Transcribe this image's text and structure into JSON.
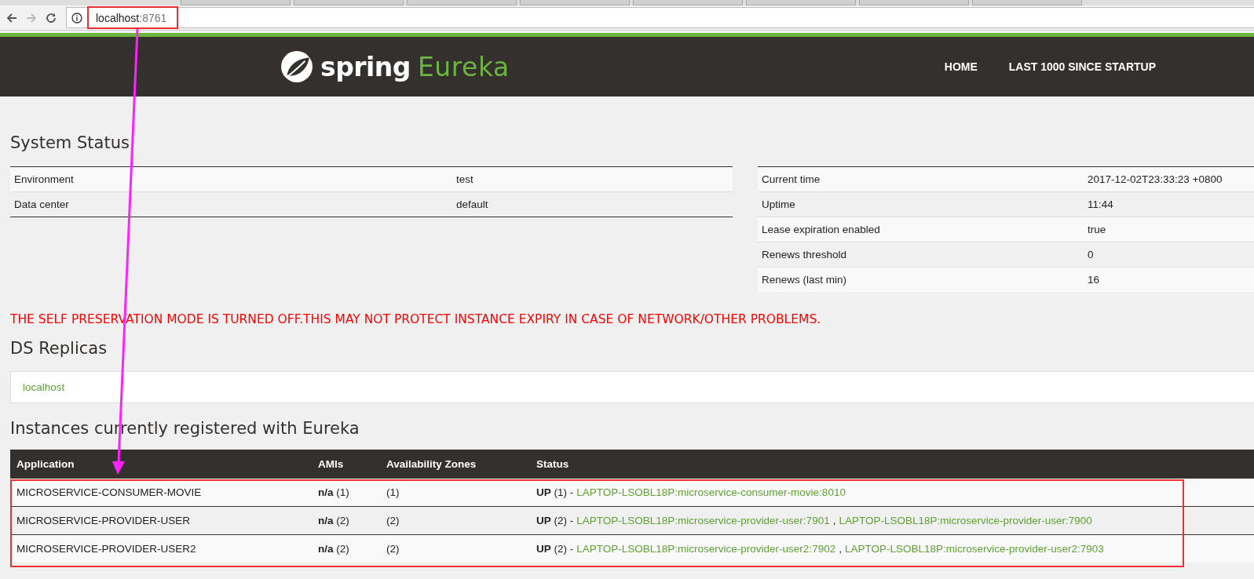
{
  "browser": {
    "address": {
      "host": "localhost",
      "port": ":8761"
    }
  },
  "header": {
    "brand": "spring",
    "product": "Eureka",
    "nav": [
      {
        "label": "HOME"
      },
      {
        "label": "LAST 1000 SINCE STARTUP"
      }
    ]
  },
  "system_status": {
    "title": "System Status",
    "left": [
      {
        "key": "Environment",
        "value": "test"
      },
      {
        "key": "Data center",
        "value": "default"
      }
    ],
    "right": [
      {
        "key": "Current time",
        "value": "2017-12-02T23:33:23 +0800"
      },
      {
        "key": "Uptime",
        "value": "11:44"
      },
      {
        "key": "Lease expiration enabled",
        "value": "true"
      },
      {
        "key": "Renews threshold",
        "value": "0"
      },
      {
        "key": "Renews (last min)",
        "value": "16"
      }
    ]
  },
  "warning": "THE SELF PRESERVATION MODE IS TURNED OFF.THIS MAY NOT PROTECT INSTANCE EXPIRY IN CASE OF NETWORK/OTHER PROBLEMS.",
  "replicas": {
    "title": "DS Replicas",
    "items": [
      "localhost"
    ]
  },
  "instances": {
    "title": "Instances currently registered with Eureka",
    "columns": [
      "Application",
      "AMIs",
      "Availability Zones",
      "Status"
    ],
    "rows": [
      {
        "application": "MICROSERVICE-CONSUMER-MOVIE",
        "amis": "**n/a** (1)",
        "zones": "(1)",
        "status": "**UP** (1) -",
        "links": [
          {
            "text": "LAPTOP-LSOBL18P:microservice-consumer-movie:8010"
          }
        ]
      },
      {
        "application": "MICROSERVICE-PROVIDER-USER",
        "amis": "**n/a** (2)",
        "zones": "(2)",
        "status": "**UP** (2) -",
        "links": [
          {
            "text": "LAPTOP-LSOBL18P:microservice-provider-user:7901",
            "after": ","
          },
          {
            "text": "LAPTOP-LSOBL18P:microservice-provider-user:7900"
          }
        ]
      },
      {
        "application": "MICROSERVICE-PROVIDER-USER2",
        "amis": "**n/a** (2)",
        "zones": "(2)",
        "status": "**UP** (2) -",
        "links": [
          {
            "text": "LAPTOP-LSOBL18P:microservice-provider-user2:7902",
            "after": ","
          },
          {
            "text": "LAPTOP-LSOBL18P:microservice-provider-user2:7903"
          }
        ]
      }
    ]
  }
}
